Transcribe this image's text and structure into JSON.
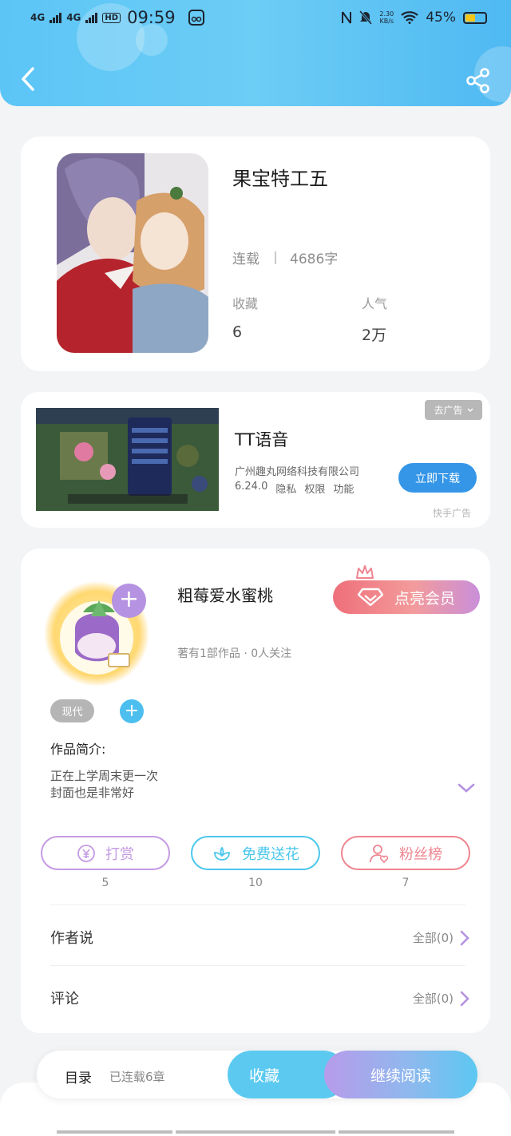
{
  "status_bar": {
    "net1": "4G",
    "net2": "4G",
    "hd": "HD",
    "time": "09:59",
    "speed_value": "2.30",
    "speed_unit": "KB/s",
    "battery": "45%"
  },
  "book": {
    "title": "果宝特工五",
    "status": "连载",
    "word_count": "4686字",
    "stats": [
      {
        "label": "收藏",
        "value": "6"
      },
      {
        "label": "人气",
        "value": "2万"
      }
    ]
  },
  "ad": {
    "title": "TT语音",
    "company": "广州趣丸网络科技有限公司",
    "version": "6.24.0",
    "links": [
      "隐私",
      "权限",
      "功能"
    ],
    "close_label": "去广告",
    "download_label": "立即下载",
    "source": "快手广告"
  },
  "author": {
    "name": "粗莓爱水蜜桃",
    "info": "著有1部作品 · 0人关注",
    "vip_label": "点亮会员",
    "genre_tag": "现代",
    "intro_label": "作品简介:",
    "intro_lines": [
      "正在上学周末更一次",
      "封面也是非常好"
    ]
  },
  "actions": [
    {
      "label": "打赏",
      "count": "5",
      "color": "#c59be3"
    },
    {
      "label": "免费送花",
      "count": "10",
      "color": "#4bc7ec"
    },
    {
      "label": "粉丝榜",
      "count": "7",
      "color": "#ef8590"
    }
  ],
  "rows": [
    {
      "label": "作者说",
      "right": "全部(0)"
    },
    {
      "label": "评论",
      "right": "全部(0)"
    }
  ],
  "bottom_bar": {
    "toc": "目录",
    "chapters": "已连载6章",
    "collect": "收藏",
    "read": "继续阅读"
  },
  "colors": {
    "header": "#5cc5f6",
    "accent_purple": "#b592e2",
    "accent_blue": "#4dbfef",
    "vip_pink": "#ee6f7a"
  }
}
